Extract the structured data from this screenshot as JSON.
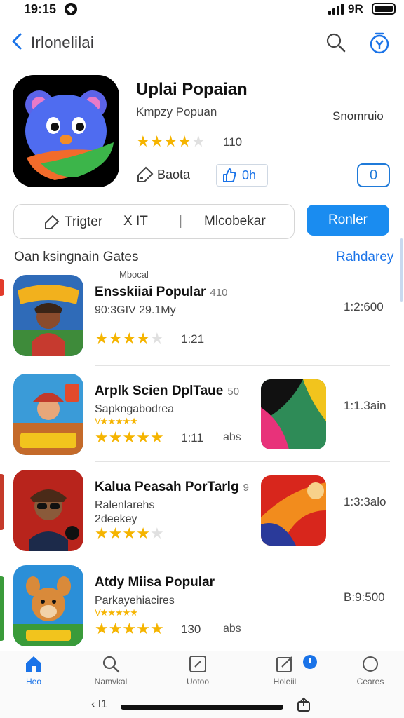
{
  "status": {
    "time": "19:15",
    "carrier": "9R"
  },
  "nav": {
    "title": "Irlonelilai"
  },
  "hero": {
    "name": "Uplai Popaian",
    "subtitle": "Kmpzy Popuan",
    "right_label": "Snomruio",
    "rating": 3.5,
    "rating_text": "110",
    "action1": "Baota",
    "action2": "0h",
    "count": "0"
  },
  "filter": {
    "item1": "Trigter",
    "item2": "X IT",
    "separator": "|",
    "item3": "Mlcobekar"
  },
  "cta": "Ronler",
  "section": {
    "title": "Oan ksingnain Gates",
    "link": "Rahdarey"
  },
  "list": [
    {
      "tag": "Mbocal",
      "name": "Ensskiiai Popular",
      "num": "410",
      "sub1": "90:3GIV 29.1My",
      "mini": "",
      "rating": 3.5,
      "count": "1:21",
      "extra": "",
      "time": "1:2:600"
    },
    {
      "tag": "",
      "name": "Arplk Scien DplTaue",
      "num": "50",
      "sub1": "Sapkngabodrea",
      "mini": "V★★★★★",
      "rating": 4.5,
      "count": "1:11",
      "extra": "abs",
      "time": "1:1.3ain"
    },
    {
      "tag": "",
      "name": "Kalua Peasah PorTarlg",
      "num": "9",
      "sub1": "Ralenlarehs",
      "sub2": "2deekey",
      "mini": "",
      "rating": 4,
      "count": "",
      "extra": "",
      "time": "1:3:3alo"
    },
    {
      "tag": "",
      "name": "Atdy Miisa Popular",
      "num": "",
      "sub1": "Parkayehiacires",
      "mini": "V★★★★★",
      "rating": 4.5,
      "count": "130",
      "extra": "abs",
      "time": "B:9:500"
    }
  ],
  "tabs": [
    {
      "label": "Heo",
      "icon": "home-icon"
    },
    {
      "label": "Namvkal",
      "icon": "search-icon"
    },
    {
      "label": "Uotoo",
      "icon": "edit-box-icon"
    },
    {
      "label": "Holeiil",
      "icon": "compose-icon"
    },
    {
      "label": "Ceares",
      "icon": "circle-icon"
    }
  ],
  "bottom": {
    "left": "‹ I1"
  },
  "colors": {
    "accent": "#1a8cf0",
    "star": "#f5b400",
    "link": "#1a73e8"
  }
}
